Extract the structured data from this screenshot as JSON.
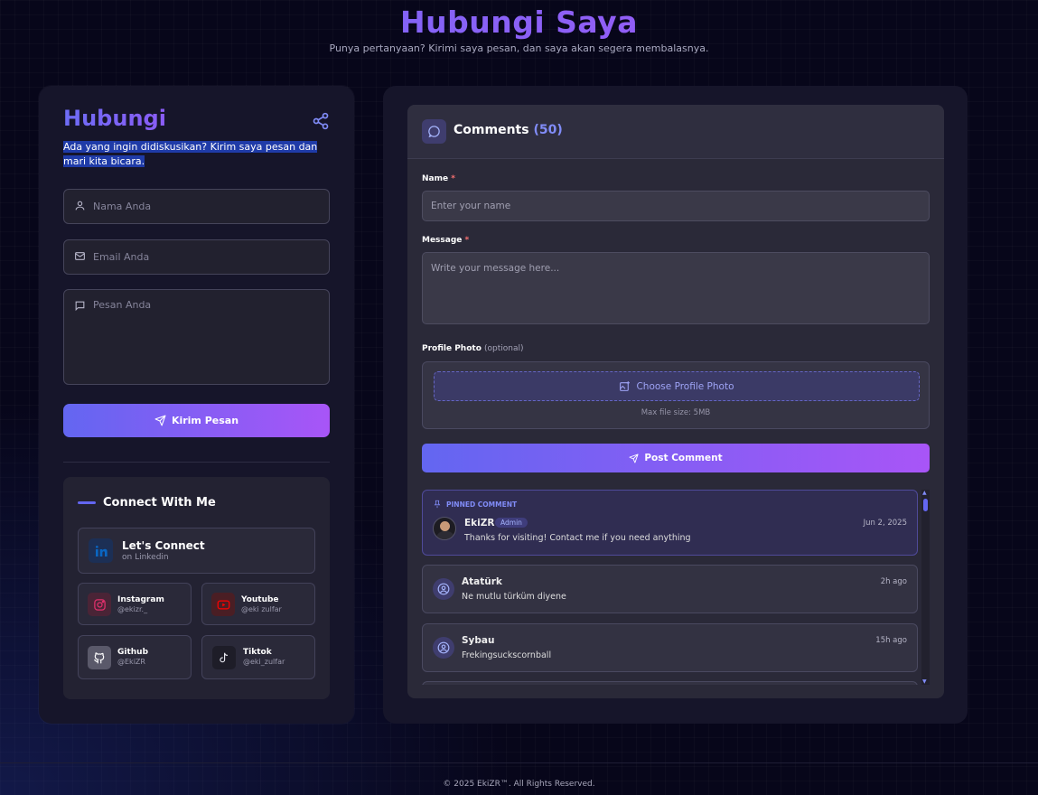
{
  "header": {
    "title": "Hubungi Saya",
    "subtitle": "Punya pertanyaan? Kirimi saya pesan, dan saya akan segera membalasnya."
  },
  "contact": {
    "title": "Hubungi",
    "subtitle": "Ada yang ingin didiskusikan? Kirim saya pesan dan mari kita bicara.",
    "name_placeholder": "Nama Anda",
    "email_placeholder": "Email Anda",
    "message_placeholder": "Pesan Anda",
    "send_label": "Kirim Pesan"
  },
  "connect": {
    "title": "Connect With Me",
    "linkedin": {
      "name": "Let's Connect",
      "handle": "on Linkedin",
      "color": "#0a66c2"
    },
    "instagram": {
      "name": "Instagram",
      "handle": "@ekizr._",
      "color": "#e1306c"
    },
    "youtube": {
      "name": "Youtube",
      "handle": "@eki zulfar",
      "color": "#ff0000"
    },
    "github": {
      "name": "Github",
      "handle": "@EkiZR",
      "color": "#ffffff"
    },
    "tiktok": {
      "name": "Tiktok",
      "handle": "@eki_zulfar",
      "color": "#25f4ee"
    }
  },
  "comments": {
    "title": "Comments",
    "count": "(50)",
    "name_label": "Name",
    "required": "*",
    "name_placeholder": "Enter your name",
    "message_label": "Message",
    "message_placeholder": "Write your message here...",
    "photo_label": "Profile Photo",
    "photo_optional": "(optional)",
    "choose_label": "Choose Profile Photo",
    "max_size": "Max file size: 5MB",
    "post_label": "Post Comment",
    "pinned_label": "PINNED COMMENT",
    "items": [
      {
        "name": "EkiZR",
        "badge": "Admin",
        "time": "Jun 2, 2025",
        "message": "Thanks for visiting! Contact me if you need anything"
      },
      {
        "name": "Atatürk",
        "time": "2h ago",
        "message": "Ne mutlu türküm diyene"
      },
      {
        "name": "Sybau",
        "time": "15h ago",
        "message": "Frekingsuckscornball"
      }
    ]
  },
  "footer": {
    "text": "© 2025 EkiZR™. All Rights Reserved."
  },
  "colors": {
    "accent": "#6366f1",
    "accent2": "#a855f7",
    "background": "#07061a",
    "card": "#16152a"
  }
}
